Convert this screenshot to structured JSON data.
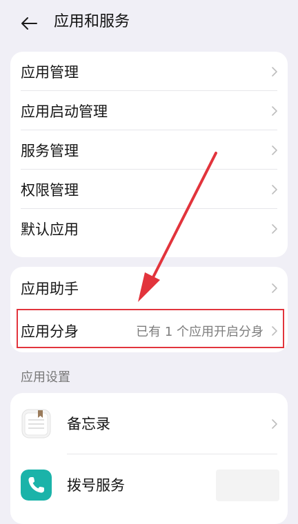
{
  "header": {
    "title": "应用和服务",
    "back_icon": "arrow-left-icon"
  },
  "group1": {
    "items": [
      {
        "label": "应用管理"
      },
      {
        "label": "应用启动管理"
      },
      {
        "label": "服务管理"
      },
      {
        "label": "权限管理"
      },
      {
        "label": "默认应用"
      }
    ]
  },
  "group2": {
    "items": [
      {
        "label": "应用助手",
        "value": ""
      },
      {
        "label": "应用分身",
        "value": "已有 1 个应用开启分身"
      }
    ]
  },
  "section": {
    "title": "应用设置"
  },
  "apps": {
    "items": [
      {
        "label": "备忘录",
        "icon": "notepad-icon"
      },
      {
        "label": "拨号服务",
        "icon": "phone-icon"
      }
    ]
  },
  "colors": {
    "background": "#f0eff6",
    "card": "#ffffff",
    "annotation": "#e2343c",
    "dialer": "#1bb3a9"
  }
}
